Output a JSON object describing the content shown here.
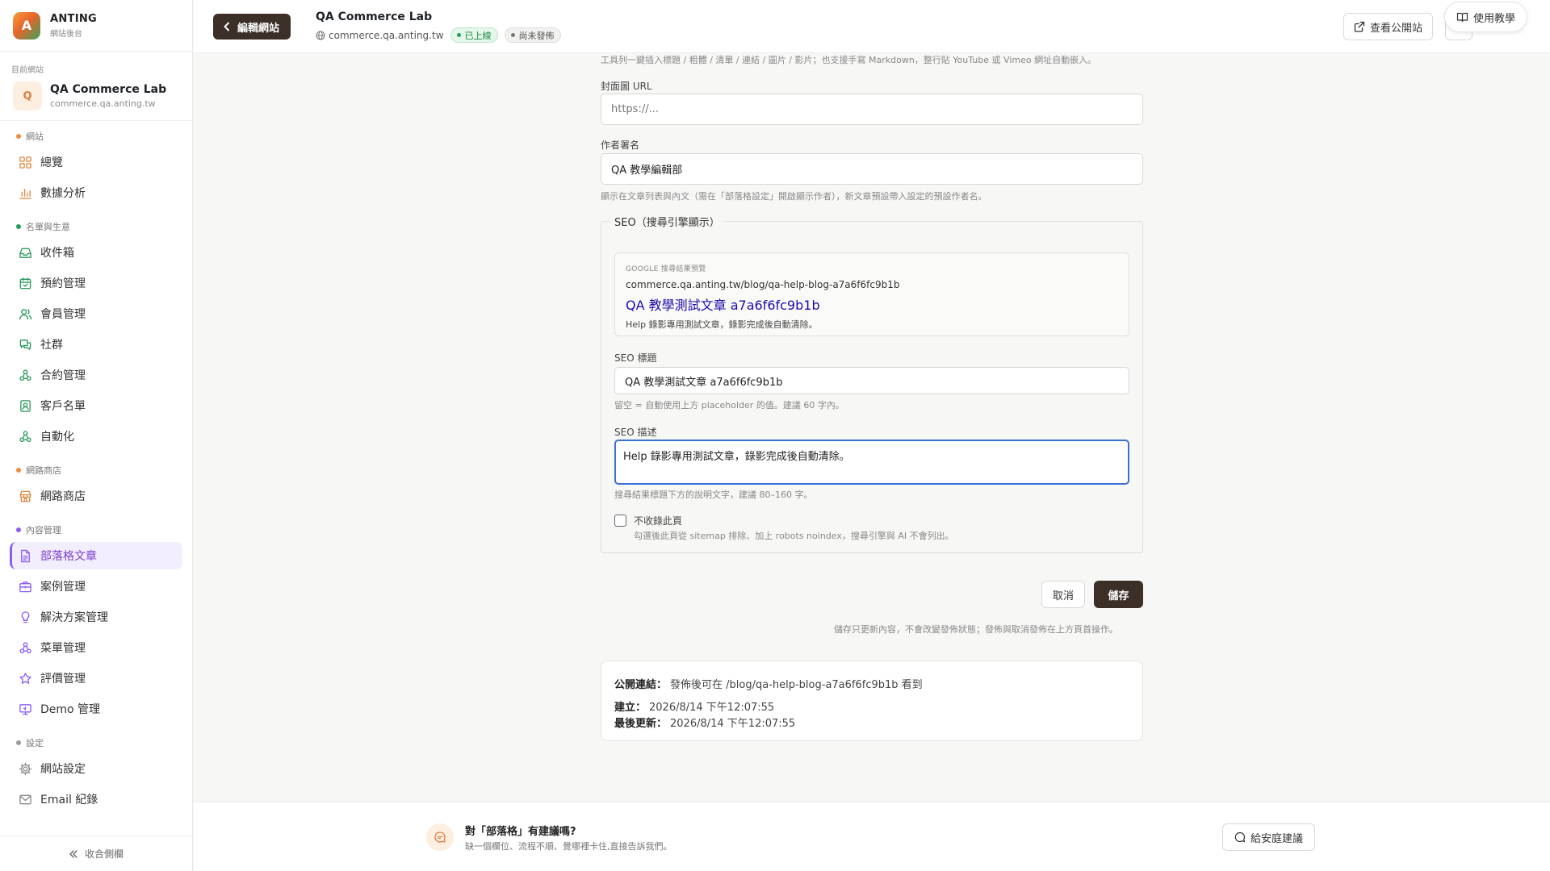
{
  "brand": {
    "logo_letter": "A",
    "name": "ANTING",
    "subtitle": "網站後台"
  },
  "current_site": {
    "label": "目前網站",
    "avatar_letter": "Q",
    "name": "QA Commerce Lab",
    "domain": "commerce.qa.anting.tw"
  },
  "nav": {
    "groups": [
      {
        "label": "網站",
        "dot_color": "#f08a3c",
        "items": [
          {
            "label": "總覽",
            "icon": "grid-icon"
          },
          {
            "label": "數據分析",
            "icon": "bar-chart-icon"
          }
        ]
      },
      {
        "label": "名單與生意",
        "dot_color": "#22a05a",
        "items": [
          {
            "label": "收件箱",
            "icon": "inbox-icon"
          },
          {
            "label": "預約管理",
            "icon": "calendar-icon"
          },
          {
            "label": "會員管理",
            "icon": "users-icon"
          },
          {
            "label": "社群",
            "icon": "chat-icon"
          },
          {
            "label": "合約管理",
            "icon": "workflow-icon"
          },
          {
            "label": "客戶名單",
            "icon": "contact-icon"
          },
          {
            "label": "自動化",
            "icon": "workflow-icon"
          }
        ]
      },
      {
        "label": "網路商店",
        "dot_color": "#f08a3c",
        "items": [
          {
            "label": "網路商店",
            "icon": "store-icon"
          }
        ]
      },
      {
        "label": "內容管理",
        "dot_color": "#8b5cf6",
        "items": [
          {
            "label": "部落格文章",
            "icon": "document-icon",
            "active": true
          },
          {
            "label": "案例管理",
            "icon": "briefcase-icon"
          },
          {
            "label": "解決方案管理",
            "icon": "lightbulb-icon"
          },
          {
            "label": "菜單管理",
            "icon": "workflow-icon"
          },
          {
            "label": "評價管理",
            "icon": "star-icon"
          },
          {
            "label": "Demo 管理",
            "icon": "monitor-icon"
          }
        ]
      },
      {
        "label": "設定",
        "dot_color": "#9a9a9a",
        "items": [
          {
            "label": "網站設定",
            "icon": "gear-icon"
          },
          {
            "label": "Email 紀錄",
            "icon": "mail-icon"
          }
        ]
      }
    ],
    "collapse_label": "收合側欄"
  },
  "topbar": {
    "back_label": "編輯網站",
    "site_title": "QA Commerce Lab",
    "site_domain": "commerce.qa.anting.tw",
    "status_online": "已上線",
    "status_unpublished": "尚未發佈",
    "view_site_label": "查看公開站",
    "help_label": "使用教學"
  },
  "form": {
    "editor_hint": "工具列一鍵插入標題 / 粗體 / 清單 / 連結 / 圖片 / 影片；也支援手寫 Markdown，整行貼 YouTube 或 Vimeo 網址自動嵌入。",
    "cover": {
      "label": "封面圖 URL",
      "value": "",
      "placeholder": "https://..."
    },
    "author": {
      "label": "作者署名",
      "value": "QA 教學編輯部",
      "hint": "顯示在文章列表與內文（需在「部落格設定」開啟顯示作者），新文章預設帶入設定的預設作者名。"
    },
    "seo": {
      "legend": "SEO（搜尋引擎顯示）",
      "preview": {
        "label": "GOOGLE 搜尋結果預覽",
        "url": "commerce.qa.anting.tw/blog/qa-help-blog-a7a6f6fc9b1b",
        "title": "QA 教學測試文章 a7a6f6fc9b1b",
        "description": "Help 錄影專用測試文章，錄影完成後自動清除。"
      },
      "title_field": {
        "label": "SEO 標題",
        "value": "QA 教學測試文章 a7a6f6fc9b1b",
        "hint": "留空 = 自動使用上方 placeholder 的值。建議 60 字內。"
      },
      "description_field": {
        "label": "SEO 描述",
        "value": "Help 錄影專用測試文章，錄影完成後自動清除。",
        "hint": "搜尋結果標題下方的說明文字，建議 80–160 字。"
      },
      "noindex": {
        "label": "不收錄此頁",
        "hint": "勾選後此頁從 sitemap 排除、加上 robots noindex，搜尋引擎與 AI 不會列出。",
        "checked": false
      }
    },
    "cancel_label": "取消",
    "save_label": "儲存",
    "save_note": "儲存只更新內容，不會改變發佈狀態；發佈與取消發佈在上方頁首操作。"
  },
  "info": {
    "public_link_label": "公開連結：",
    "public_link_value": "發佈後可在 /blog/qa-help-blog-a7a6f6fc9b1b 看到",
    "created_label": "建立：",
    "created_value": "2026/8/14 下午12:07:55",
    "updated_label": "最後更新：",
    "updated_value": "2026/8/14 下午12:07:55"
  },
  "feedback": {
    "title": "對「部落格」有建議嗎?",
    "subtitle": "缺一個欄位、流程不順、覺哪裡卡住,直接告訴我們。",
    "button_label": "給安庭建議"
  },
  "colors": {
    "accent_dark": "#3b2f28",
    "active_purple": "#7a3fd0",
    "focus_blue": "#3b6fd6",
    "google_link": "#1a0dab"
  }
}
